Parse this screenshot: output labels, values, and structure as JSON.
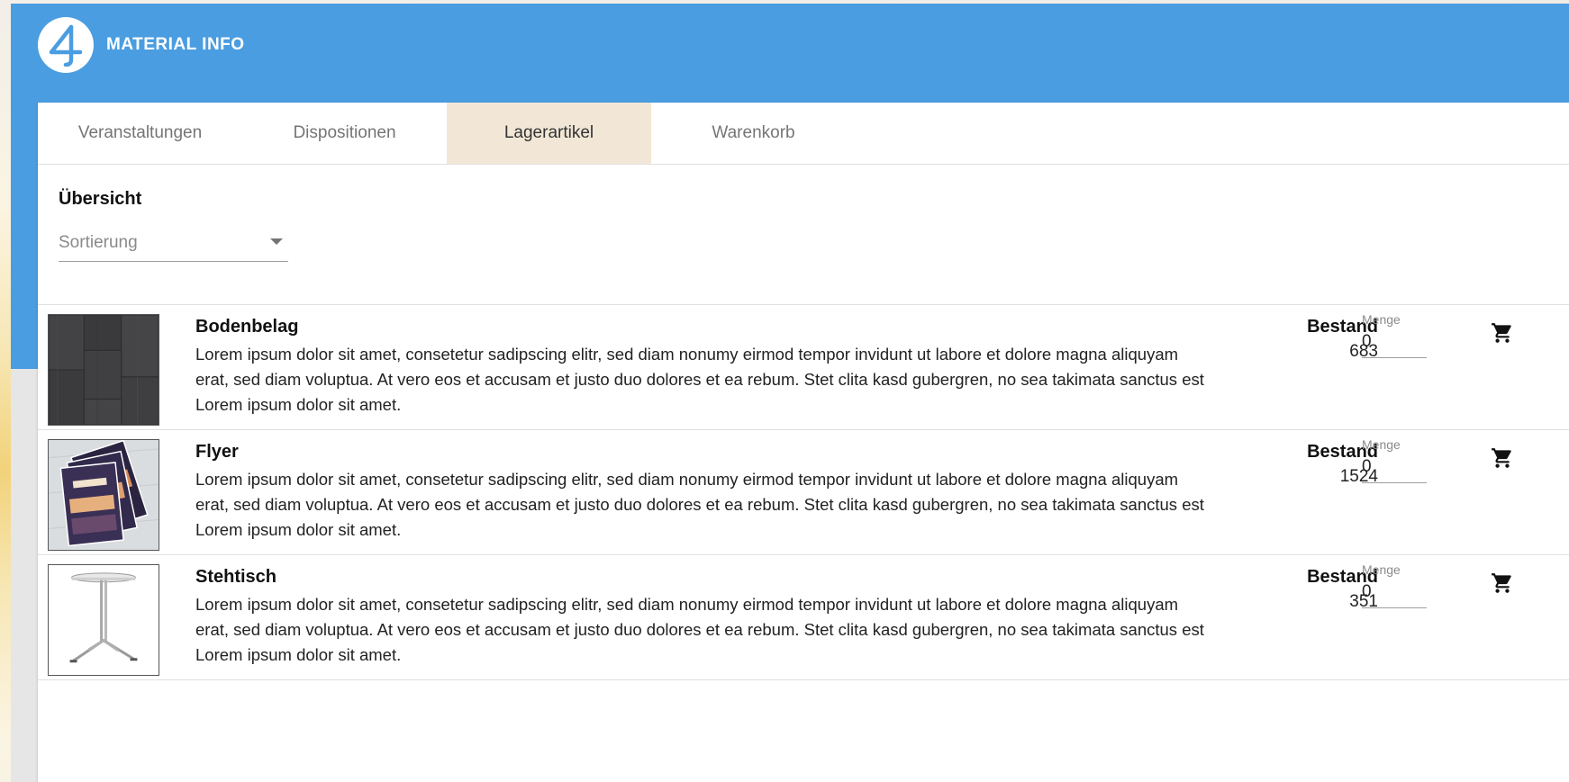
{
  "brand": {
    "logo_glyph": "4",
    "title": "MATERIAL INFO"
  },
  "tabs": [
    {
      "label": "Veranstaltungen",
      "active": false
    },
    {
      "label": "Dispositionen",
      "active": false
    },
    {
      "label": "Lagerartikel",
      "active": true
    },
    {
      "label": "Warenkorb",
      "active": false
    }
  ],
  "overview": {
    "title": "Übersicht",
    "sort_placeholder": "Sortierung"
  },
  "items": [
    {
      "name": "Bodenbelag",
      "description": "Lorem ipsum dolor sit amet, consetetur sadipscing elitr, sed diam nonumy eirmod tempor invidunt ut labore et dolore magna aliquyam erat, sed diam voluptua. At vero eos et accusam et justo duo dolores et ea rebum. Stet clita kasd gubergren, no sea takimata sanctus est Lorem ipsum dolor sit amet.",
      "stock_label": "Bestand",
      "stock": "683",
      "qty_label": "Menge",
      "qty": "0",
      "image": "floor-tiles-image"
    },
    {
      "name": "Flyer",
      "description": "Lorem ipsum dolor sit amet, consetetur sadipscing elitr, sed diam nonumy eirmod tempor invidunt ut labore et dolore magna aliquyam erat, sed diam voluptua. At vero eos et accusam et justo duo dolores et ea rebum. Stet clita kasd gubergren, no sea takimata sanctus est Lorem ipsum dolor sit amet.",
      "stock_label": "Bestand",
      "stock": "1524",
      "qty_label": "Menge",
      "qty": "0",
      "image": "flyer-stack-image"
    },
    {
      "name": "Stehtisch",
      "description": "Lorem ipsum dolor sit amet, consetetur sadipscing elitr, sed diam nonumy eirmod tempor invidunt ut labore et dolore magna aliquyam erat, sed diam voluptua. At vero eos et accusam et justo duo dolores et ea rebum. Stet clita kasd gubergren, no sea takimata sanctus est Lorem ipsum dolor sit amet.",
      "stock_label": "Bestand",
      "stock": "351",
      "qty_label": "Menge",
      "qty": "0",
      "image": "high-table-image"
    }
  ],
  "icons": {
    "cart": "cart-icon"
  },
  "colors": {
    "header": "#4a9de0",
    "active_tab": "#f2e7d7"
  }
}
